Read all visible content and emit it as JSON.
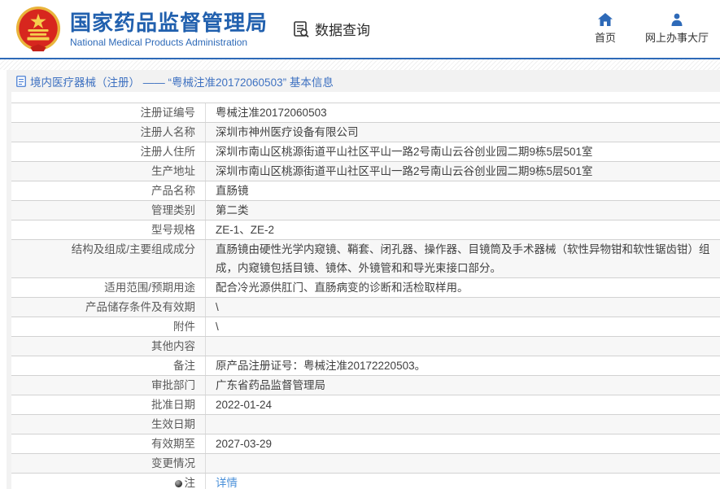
{
  "header": {
    "org_name_cn": "国家药品监督管理局",
    "org_name_en": "National Medical Products Administration",
    "section_title": "数据查询",
    "nav": [
      {
        "label": "首页"
      },
      {
        "label": "网上办事大厅"
      }
    ]
  },
  "breadcrumb": {
    "text": "境内医疗器械（注册） —— “粤械注准20172060503” 基本信息"
  },
  "table": {
    "rows": [
      {
        "label": "注册证编号",
        "value": "粤械注准20172060503"
      },
      {
        "label": "注册人名称",
        "value": "深圳市神州医疗设备有限公司"
      },
      {
        "label": "注册人住所",
        "value": "深圳市南山区桃源街道平山社区平山一路2号南山云谷创业园二期9栋5层501室"
      },
      {
        "label": "生产地址",
        "value": "深圳市南山区桃源街道平山社区平山一路2号南山云谷创业园二期9栋5层501室"
      },
      {
        "label": "产品名称",
        "value": "直肠镜"
      },
      {
        "label": "管理类别",
        "value": "第二类"
      },
      {
        "label": "型号规格",
        "value": "ZE-1、ZE-2"
      },
      {
        "label": "结构及组成/主要组成成分",
        "value": "直肠镜由硬性光学内窥镜、鞘套、闭孔器、操作器、目镜筒及手术器械（软性异物钳和软性锯齿钳）组成，内窥镜包括目镜、镜体、外镜管和和导光束接口部分。"
      },
      {
        "label": "适用范围/预期用途",
        "value": "配合冷光源供肛门、直肠病变的诊断和活检取样用。"
      },
      {
        "label": "产品储存条件及有效期",
        "value": "\\"
      },
      {
        "label": "附件",
        "value": "\\"
      },
      {
        "label": "其他内容",
        "value": ""
      },
      {
        "label": "备注",
        "value": "原产品注册证号：粤械注准20172220503。"
      },
      {
        "label": "审批部门",
        "value": "广东省药品监督管理局"
      },
      {
        "label": "批准日期",
        "value": "2022-01-24"
      },
      {
        "label": "生效日期",
        "value": ""
      },
      {
        "label": "有效期至",
        "value": "2027-03-29"
      },
      {
        "label": "变更情况",
        "value": ""
      },
      {
        "label": "注",
        "value": "详情",
        "icon": "note-icon",
        "link": true
      }
    ]
  },
  "icons": {
    "nmpa-emblem-logo": "china national emblem (red/gold circle)",
    "data-query-icon": "list document with magnifier",
    "home-icon": "filled house",
    "person-icon": "filled person",
    "document-icon": "blue outlined page",
    "note-icon": "dark sphere bullet"
  },
  "colors": {
    "brand_blue": "#2160ae",
    "nav_icon_blue": "#2e6ab8",
    "link_blue": "#4a90d9",
    "breadcrumb_blue": "#3e71c1",
    "emblem_red": "#d7261e",
    "emblem_gold": "#f0c24b",
    "row_alt_gray": "#f7f7f7"
  }
}
